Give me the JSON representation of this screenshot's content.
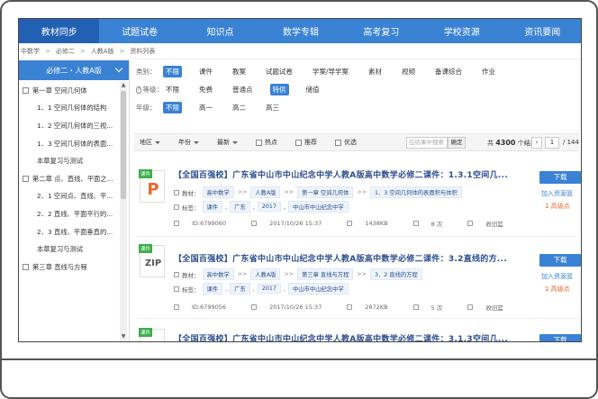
{
  "nav": [
    "教材同步",
    "试题试卷",
    "知识点",
    "数学专辑",
    "高考复习",
    "学校资源",
    "资讯要闻"
  ],
  "breadcrumb": [
    "中数学",
    ">",
    "必修二",
    ">",
    "人教A版",
    ">",
    "资料列表"
  ],
  "sidebar": {
    "header": "必修二・人教A版",
    "items": [
      {
        "type": "chapter",
        "label": "第一章 空间几何体"
      },
      {
        "type": "sub",
        "label": "1．1 空间几何体的结构"
      },
      {
        "type": "sub",
        "label": "1．2 空间几何体的三视..."
      },
      {
        "type": "sub",
        "label": "1．3 空间几何体的表面..."
      },
      {
        "type": "review",
        "label": "本章复习与测试"
      },
      {
        "type": "chapter",
        "label": "第二章 点、直线、平面之..."
      },
      {
        "type": "sub",
        "label": "2．1 空间点、直线、平..."
      },
      {
        "type": "sub",
        "label": "2．2 直线、平面平行的..."
      },
      {
        "type": "sub",
        "label": "2．3 直线、平面垂直的..."
      },
      {
        "type": "review",
        "label": "本章复习与测试"
      },
      {
        "type": "chapter",
        "label": "第三章 直线与方程"
      }
    ]
  },
  "filters": {
    "type": {
      "label": "类别：",
      "options": [
        "不限",
        "课件",
        "教案",
        "试题试卷",
        "学案/导学案",
        "素材",
        "视频",
        "备课综合",
        "作业"
      ],
      "selected": 0
    },
    "level": {
      "label": "等级：",
      "options": [
        "不限",
        "免费",
        "普通点",
        "特供",
        "储值"
      ],
      "selected": 3
    },
    "year": {
      "label": "年级：",
      "options": [
        "不限",
        "高一",
        "高二",
        "高三"
      ],
      "selected": 0
    }
  },
  "sortbar": {
    "region": "地区",
    "year": "年份",
    "latest": "最新",
    "checks": [
      "热点",
      "推荐",
      "优选"
    ],
    "search_placeholder": "在结果中搜索",
    "search_btn": "确定",
    "count_prefix": "共",
    "count": "4300",
    "count_suffix": "个结果",
    "page_current": "1",
    "page_total": "/ 144",
    "prev": "‹",
    "next": "›"
  },
  "results": [
    {
      "badge": "课件",
      "icon": "P",
      "title": "【全国百强校】广东省中山市中山纪念中学人教A版高中数学必修二课件：1.3.1空间几...",
      "textbook_label": "教材：",
      "textbook": [
        "高中数学",
        "人教A版",
        "第一章 空间几何体",
        "1．3 空间几何体的表面积与体积"
      ],
      "tags_label": "标签：",
      "tags": [
        "课件",
        "广东",
        "2017",
        "中山市中山纪念中学"
      ],
      "id": "ID:6799060",
      "time": "2017/10/26 15:37",
      "size": "1438KB",
      "downloads": "8 次",
      "fav": "收旧篮",
      "download": "下载",
      "add": "加入资源篮",
      "points": "1 高级点"
    },
    {
      "badge": "课件",
      "icon": "ZIP",
      "title": "【全国百强校】广东省中山市中山纪念中学人教A版高中数学必修二课件：3.2直线的方...",
      "textbook_label": "教材：",
      "textbook": [
        "高中数学",
        "人教A版",
        "第三章 直线与方程",
        "3．2 直线的方程"
      ],
      "tags_label": "标签：",
      "tags": [
        "课件",
        "广东",
        "2017",
        "中山市中山纪念中学"
      ],
      "id": "ID:6799056",
      "time": "2017/10/26 15:37",
      "size": "2872KB",
      "downloads": "5 次",
      "fav": "收旧篮",
      "download": "下载",
      "add": "加入资源篮",
      "points": "1 高级点"
    },
    {
      "badge": "课件",
      "icon": "",
      "title": "【全国百强校】广东省中山市中山纪念中学人教A版高中数学必修二课件：3.1.3空间几...",
      "download": "下载"
    }
  ]
}
